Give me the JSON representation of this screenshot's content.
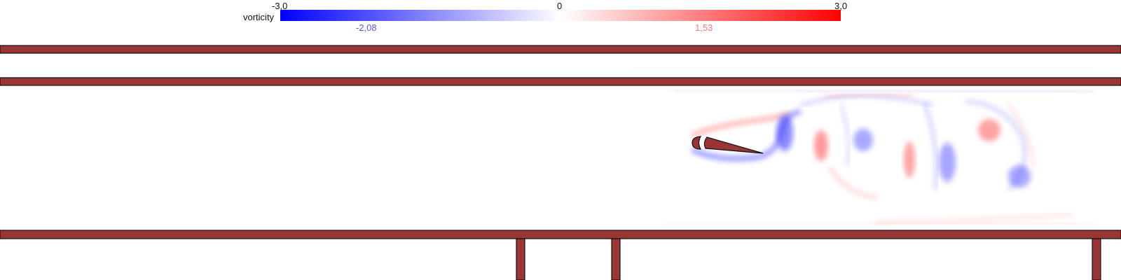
{
  "colorbar": {
    "title": "vorticity",
    "min_label": "-3,0",
    "mid_label": "0",
    "max_label": "3,0",
    "neg_extreme_label": "-2,08",
    "pos_extreme_label": "1,53",
    "min_value": -3.0,
    "max_value": 3.0,
    "neg_extreme_value": -2.08,
    "pos_extreme_value": 1.53,
    "neg_color": "#0000ff",
    "zero_color": "#ffffff",
    "pos_color": "#ff0000",
    "neg_label_color": "#5555ff",
    "pos_label_color": "#ff7777"
  },
  "scene": {
    "wall_color": "#9a3535",
    "outline_color": "#111111"
  }
}
